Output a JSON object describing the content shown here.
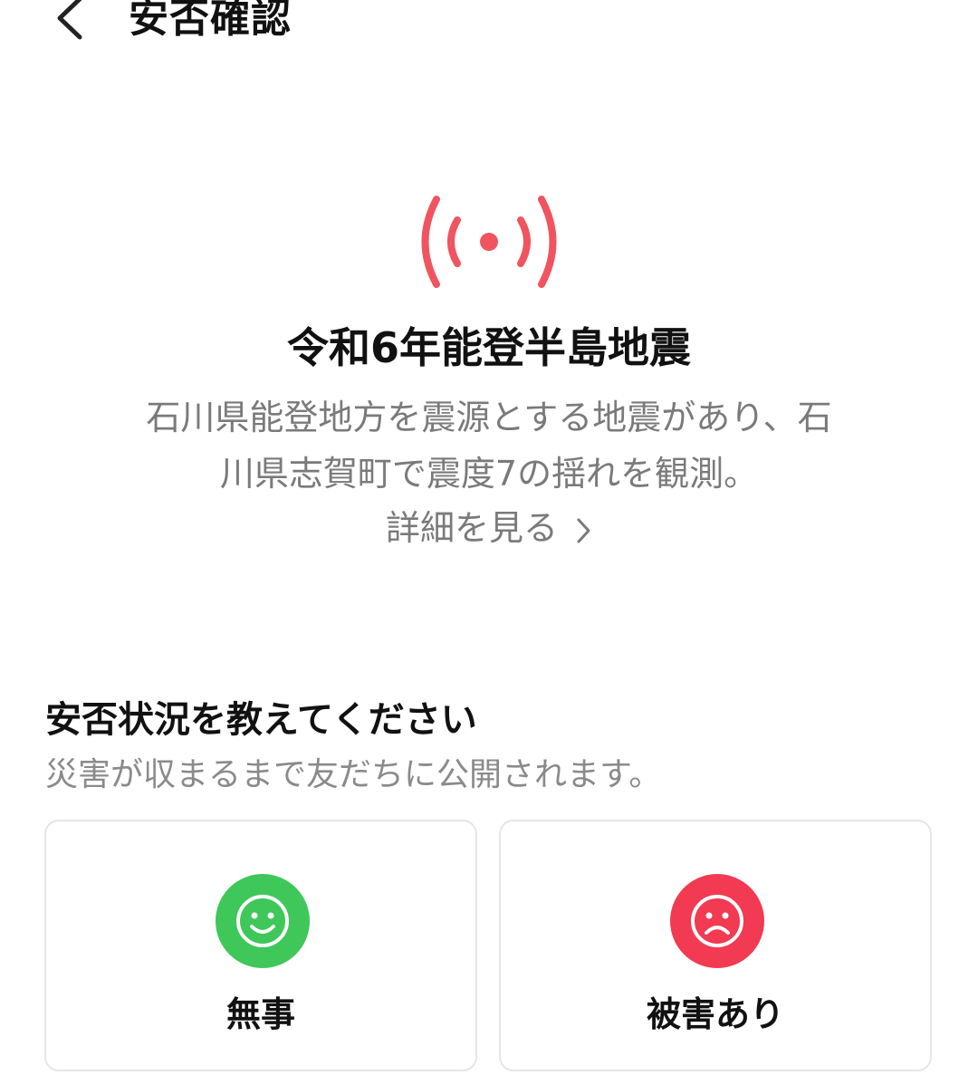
{
  "header": {
    "title": "安否確認",
    "back_icon": "chevron-left-icon"
  },
  "alert": {
    "icon": "broadcast-signal-icon",
    "color": "#f0545e",
    "title": "令和6年能登半島地震",
    "description": "石川県能登地方を震源とする地震があり、石川県志賀町で震度7の揺れを観測。",
    "details_link": "詳細を見る"
  },
  "status": {
    "heading": "安否状況を教えてください",
    "subtext": "災害が収まるまで友だちに公開されます。",
    "options": [
      {
        "label": "無事",
        "icon": "smile-face-icon",
        "color": "#3fc75a"
      },
      {
        "label": "被害あり",
        "icon": "sad-face-icon",
        "color": "#f23a52"
      }
    ]
  }
}
